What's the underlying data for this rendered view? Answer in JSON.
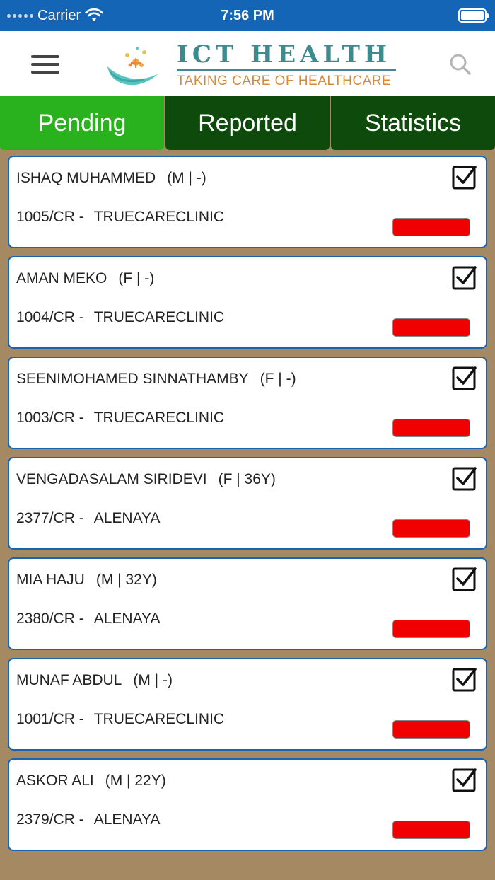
{
  "status_bar": {
    "carrier": "Carrier",
    "time": "7:56 PM"
  },
  "header": {
    "logo_title": "ICT HEALTH",
    "logo_subtitle": "TAKING CARE OF HEALTHCARE"
  },
  "tabs": [
    {
      "label": "Pending",
      "active": true
    },
    {
      "label": "Reported",
      "active": false
    },
    {
      "label": "Statistics",
      "active": false
    }
  ],
  "patients": [
    {
      "name": "ISHAQ MUHAMMED",
      "meta": "(M | -)",
      "id": "1005/CR -",
      "clinic": "TRUECARECLINIC",
      "checked": true,
      "status_color": "#f00000"
    },
    {
      "name": "AMAN MEKO",
      "meta": "(F | -)",
      "id": "1004/CR -",
      "clinic": "TRUECARECLINIC",
      "checked": true,
      "status_color": "#f00000"
    },
    {
      "name": "SEENIMOHAMED SINNATHAMBY",
      "meta": "(F | -)",
      "id": "1003/CR -",
      "clinic": "TRUECARECLINIC",
      "checked": true,
      "status_color": "#f00000"
    },
    {
      "name": "VENGADASALAM SIRIDEVI",
      "meta": "(F | 36Y)",
      "id": "2377/CR -",
      "clinic": "ALENAYA",
      "checked": true,
      "status_color": "#f00000"
    },
    {
      "name": "MIA HAJU",
      "meta": "(M | 32Y)",
      "id": "2380/CR -",
      "clinic": "ALENAYA",
      "checked": true,
      "status_color": "#f00000"
    },
    {
      "name": "MUNAF ABDUL",
      "meta": "(M | -)",
      "id": "1001/CR -",
      "clinic": "TRUECARECLINIC",
      "checked": true,
      "status_color": "#f00000"
    },
    {
      "name": "ASKOR ALI",
      "meta": "(M | 22Y)",
      "id": "2379/CR -",
      "clinic": "ALENAYA",
      "checked": true,
      "status_color": "#f00000"
    }
  ]
}
